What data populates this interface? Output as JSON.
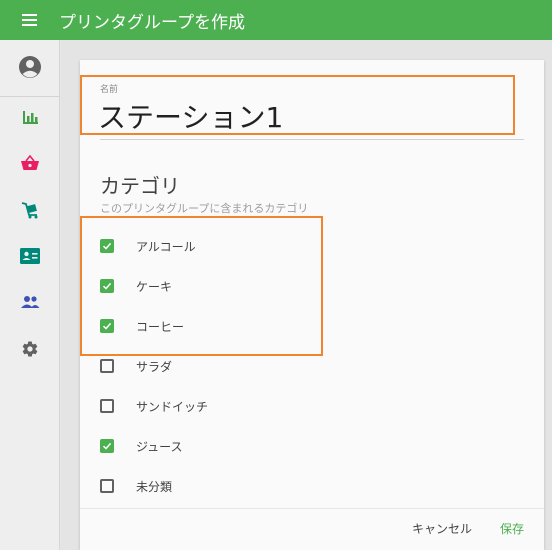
{
  "header": {
    "title": "プリンタグループを作成"
  },
  "sidebar": {
    "items": [
      {
        "icon": "account-circle-icon",
        "color": "#616161"
      },
      {
        "icon": "bar-chart-icon",
        "color": "#43a047"
      },
      {
        "icon": "basket-icon",
        "color": "#e91e63"
      },
      {
        "icon": "cart-icon",
        "color": "#00897b"
      },
      {
        "icon": "badge-card-icon",
        "color": "#00897b"
      },
      {
        "icon": "people-icon",
        "color": "#3f51b5"
      },
      {
        "icon": "gear-icon",
        "color": "#616161"
      }
    ]
  },
  "form": {
    "name_label": "名前",
    "name_value": "ステーション1",
    "section_title": "カテゴリ",
    "section_subtitle": "このプリンタグループに含まれるカテゴリ",
    "categories": [
      {
        "label": "アルコール",
        "checked": true
      },
      {
        "label": "ケーキ",
        "checked": true
      },
      {
        "label": "コーヒー",
        "checked": true
      },
      {
        "label": "サラダ",
        "checked": false
      },
      {
        "label": "サンドイッチ",
        "checked": false
      },
      {
        "label": "ジュース",
        "checked": true
      },
      {
        "label": "未分類",
        "checked": false
      }
    ]
  },
  "footer": {
    "cancel_label": "キャンセル",
    "save_label": "保存"
  },
  "colors": {
    "primary": "#4caf50",
    "highlight": "#f0852d"
  }
}
